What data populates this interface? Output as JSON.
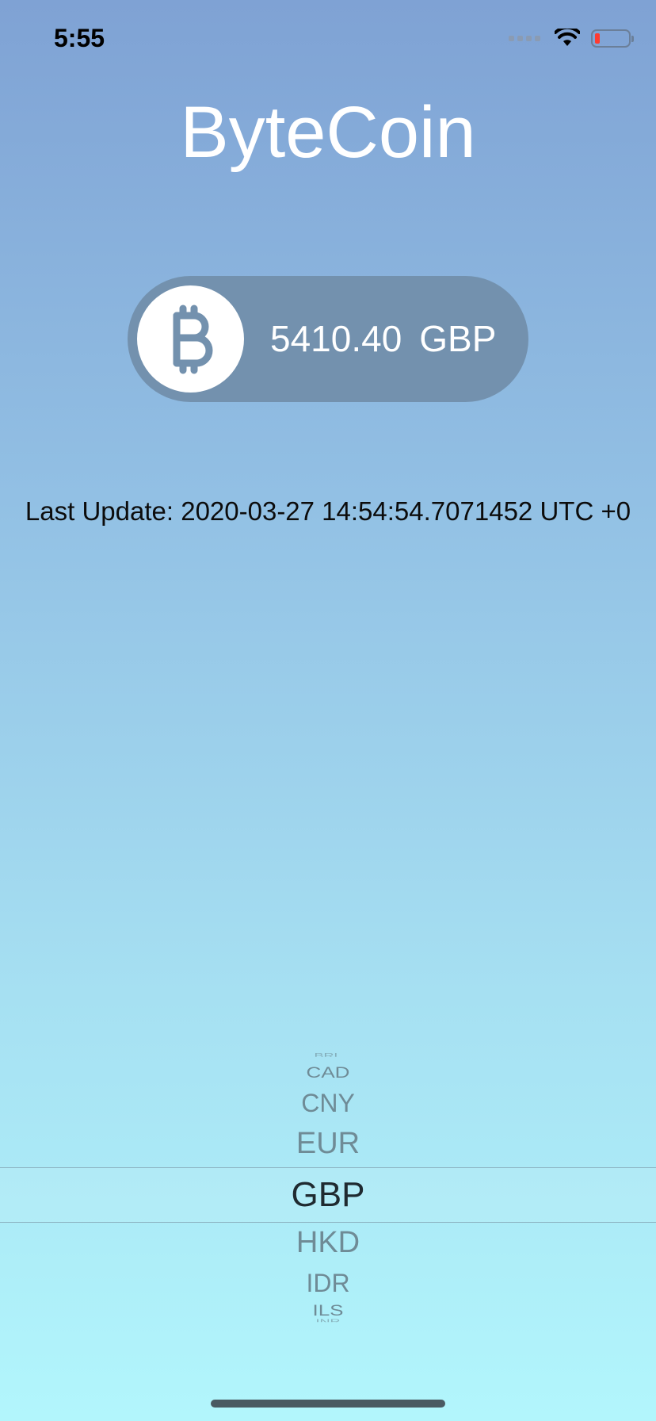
{
  "status_bar": {
    "time": "5:55"
  },
  "app": {
    "title": "ByteCoin"
  },
  "rate": {
    "value": "5410.40",
    "currency": "GBP"
  },
  "last_update": "Last Update: 2020-03-27 14:54:54.7071452 UTC +0",
  "picker": {
    "items": [
      "BRL",
      "CAD",
      "CNY",
      "EUR",
      "GBP",
      "HKD",
      "IDR",
      "ILS",
      "INR"
    ],
    "selected": "GBP"
  },
  "colors": {
    "pill": "#7391ae",
    "coin_symbol": "#7391ae",
    "title": "#ffffff"
  },
  "icons": [
    "bitcoin-icon",
    "wifi-icon",
    "battery-icon",
    "signal-icon"
  ]
}
